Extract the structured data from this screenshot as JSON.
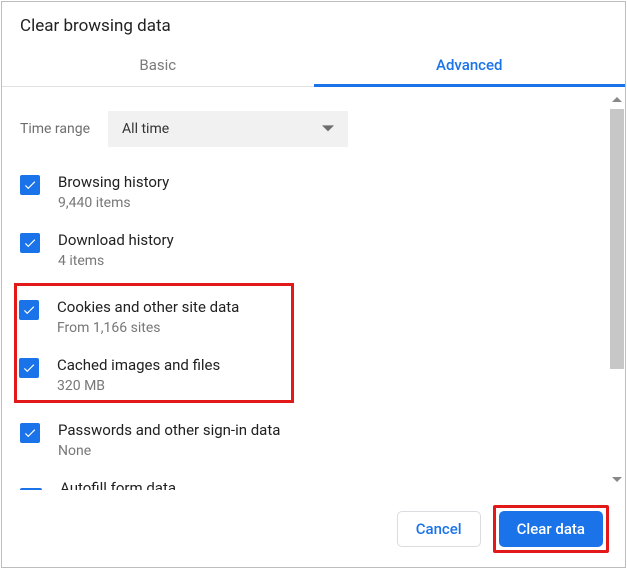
{
  "title": "Clear browsing data",
  "tabs": {
    "basic": "Basic",
    "advanced": "Advanced"
  },
  "time_range": {
    "label": "Time range",
    "value": "All time"
  },
  "items": [
    {
      "title": "Browsing history",
      "sub": "9,440 items",
      "checked": true
    },
    {
      "title": "Download history",
      "sub": "4 items",
      "checked": true
    },
    {
      "title": "Cookies and other site data",
      "sub": "From 1,166 sites",
      "checked": true
    },
    {
      "title": "Cached images and files",
      "sub": "320 MB",
      "checked": true
    },
    {
      "title": "Passwords and other sign-in data",
      "sub": "None",
      "checked": true
    },
    {
      "title": "Autofill form data",
      "sub": "",
      "checked": true
    }
  ],
  "buttons": {
    "cancel": "Cancel",
    "clear": "Clear data"
  }
}
